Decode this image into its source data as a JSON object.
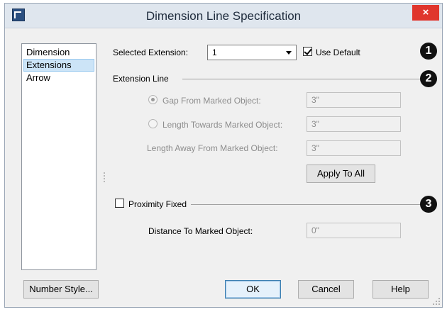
{
  "window": {
    "title": "Dimension Line Specification",
    "close_glyph": "×"
  },
  "sidebar": {
    "items": [
      {
        "label": "Dimension",
        "selected": false
      },
      {
        "label": "Extensions",
        "selected": true
      },
      {
        "label": "Arrow",
        "selected": false
      }
    ]
  },
  "selected_extension": {
    "label": "Selected Extension:",
    "value": "1",
    "use_default_label": "Use Default",
    "use_default_checked": true
  },
  "extension_line": {
    "heading": "Extension Line",
    "gap": {
      "label": "Gap From Marked Object:",
      "value": "3\"",
      "selected": true
    },
    "length_towards": {
      "label": "Length Towards Marked Object:",
      "value": "3\"",
      "selected": false
    },
    "length_away": {
      "label": "Length Away From Marked Object:",
      "value": "3\""
    },
    "apply_to_all_label": "Apply To All"
  },
  "proximity": {
    "label": "Proximity Fixed",
    "checked": false,
    "distance_label": "Distance To Marked Object:",
    "distance_value": "0\""
  },
  "buttons": {
    "number_style": "Number Style...",
    "ok": "OK",
    "cancel": "Cancel",
    "help": "Help"
  },
  "callouts": [
    "1",
    "2",
    "3"
  ],
  "icons": {
    "app": "dimension-app-icon",
    "close": "close-icon",
    "dropdown": "chevron-down-icon",
    "resize": "resize-grip-icon"
  },
  "colors": {
    "titlebar": "#dfe6ee",
    "close_button": "#e0362d",
    "selection": "#cce4f7",
    "callout": "#111111"
  }
}
